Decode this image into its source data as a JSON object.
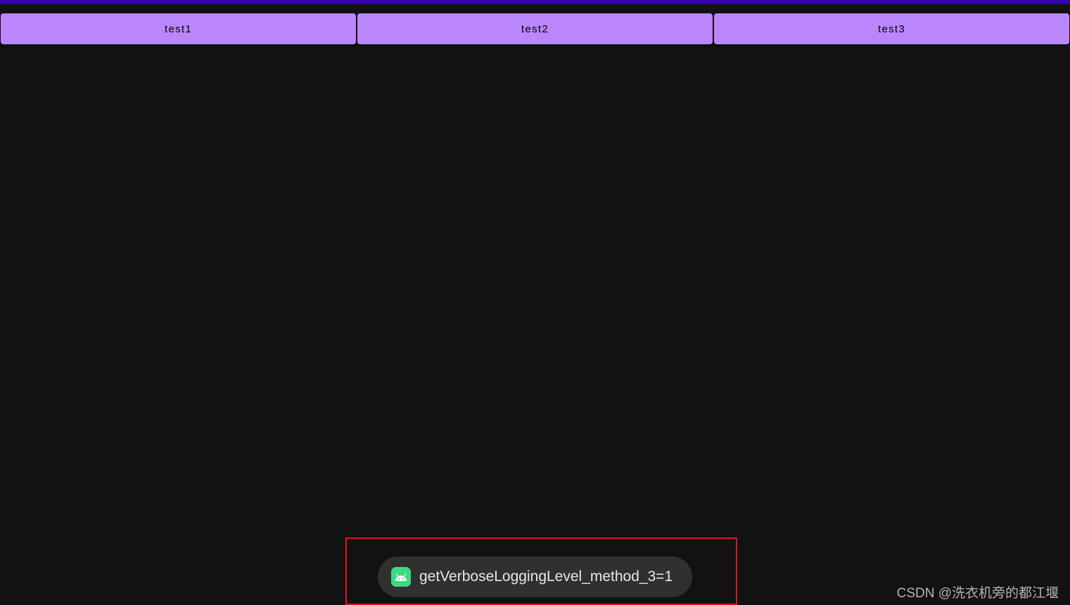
{
  "colors": {
    "status_bar": "#3700b3",
    "background": "#121212",
    "button": "#bb86fc",
    "toast_bg": "#303030",
    "highlight": "#e0161f",
    "android_green": "#3ddc84"
  },
  "buttons": [
    {
      "label": "test1"
    },
    {
      "label": "test2"
    },
    {
      "label": "test3"
    }
  ],
  "toast": {
    "icon": "android-icon",
    "message": "getVerboseLoggingLevel_method_3=1"
  },
  "watermark": {
    "text": "CSDN @洗衣机旁的都江堰"
  }
}
